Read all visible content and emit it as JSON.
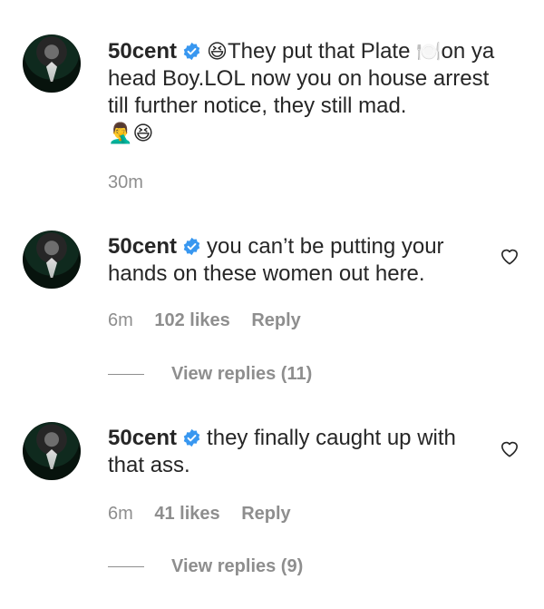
{
  "comments": [
    {
      "username": "50cent",
      "text_before": "They put that Plate",
      "text_after": "on ya head Boy.LOL now you on house arrest till further notice, they still mad.",
      "emoji_lead": "😆",
      "emoji_plate": "🍽️",
      "emoji_end": "🤦‍♂️😆",
      "time": "30m"
    },
    {
      "username": "50cent",
      "text": "you can’t be putting your hands on these women out here.",
      "time": "6m",
      "likes": "102 likes",
      "reply": "Reply",
      "view_replies": "View replies (11)"
    },
    {
      "username": "50cent",
      "text": "they finally caught up with that ass.",
      "time": "6m",
      "likes": "41 likes",
      "reply": "Reply",
      "view_replies": "View replies (9)"
    }
  ],
  "colors": {
    "verified": "#3897f0",
    "meta": "#8e8e8e",
    "text": "#262626"
  }
}
